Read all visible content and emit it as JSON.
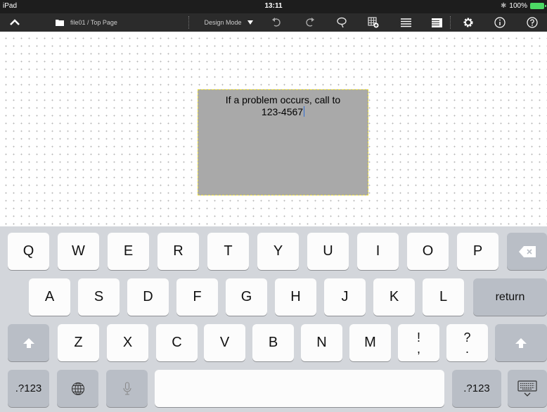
{
  "status_bar": {
    "device": "iPad",
    "time": "13:11",
    "battery": "100%",
    "bluetooth_icon": "bluetooth-icon"
  },
  "toolbar": {
    "breadcrumb": "file01 / Top Page",
    "mode": "Design Mode",
    "icons": [
      "chevron-up-icon",
      "folder-icon",
      "dropdown-arrow-icon",
      "undo-icon",
      "redo-icon",
      "lasso-icon",
      "add-table-icon",
      "list-icon",
      "list-detail-icon",
      "gear-icon",
      "info-icon",
      "help-icon"
    ]
  },
  "canvas": {
    "textbox": {
      "line1": "If a problem occurs, call to",
      "line2": "123-4567"
    }
  },
  "keyboard": {
    "row1": [
      "Q",
      "W",
      "E",
      "R",
      "T",
      "Y",
      "U",
      "I",
      "O",
      "P"
    ],
    "row2": [
      "A",
      "S",
      "D",
      "F",
      "G",
      "H",
      "J",
      "K",
      "L"
    ],
    "row3": [
      "Z",
      "X",
      "C",
      "V",
      "B",
      "N",
      "M"
    ],
    "punct1": {
      "top": "!",
      "bottom": ","
    },
    "punct2": {
      "top": "?",
      "bottom": "."
    },
    "return_label": "return",
    "numbers_label": ".?123",
    "colors": {
      "key": "#fcfcfc",
      "dark_key": "#b9bec6",
      "background": "#d3d6db"
    }
  }
}
